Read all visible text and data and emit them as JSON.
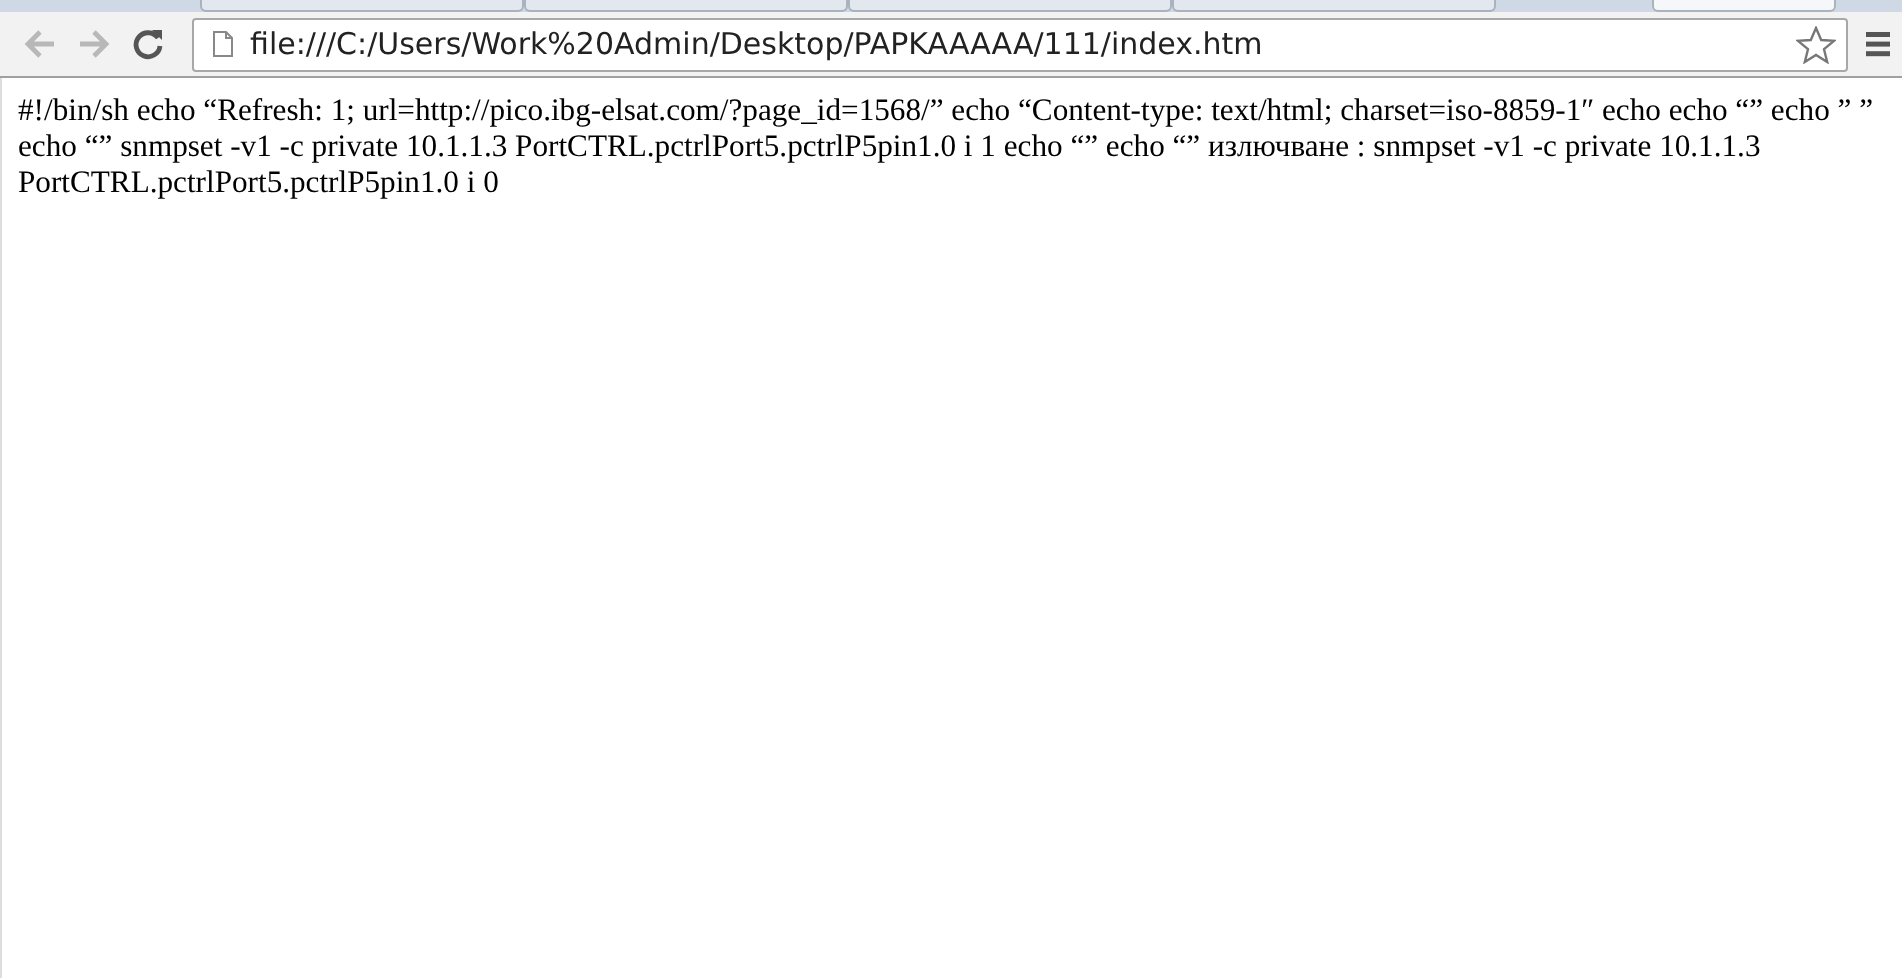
{
  "tabs": [
    {
      "selected": false
    },
    {
      "selected": false
    },
    {
      "selected": false
    },
    {
      "selected": false
    },
    {
      "selected": true
    }
  ],
  "toolbar": {
    "back": {
      "disabled": true
    },
    "forward": {
      "disabled": true
    },
    "address": "file:///C:/Users/Work%20Admin/Desktop/PAPKAAAAA/111/index.htm",
    "bookmarked": false
  },
  "page": {
    "text": "#!/bin/sh echo “Refresh: 1; url=http://pico.ibg-elsat.com/?page_id=1568/” echo “Content-type: text/html; charset=iso-8859-1″ echo echo “” echo ” ” echo “” snmpset -v1 -c private 10.1.1.3 PortCTRL.pctrlPort5.pctrlP5pin1.0 i 1 echo “” echo “” излючване : snmpset -v1 -c private 10.1.1.3 PortCTRL.pctrlPort5.pctrlP5pin1.0 i 0"
  }
}
